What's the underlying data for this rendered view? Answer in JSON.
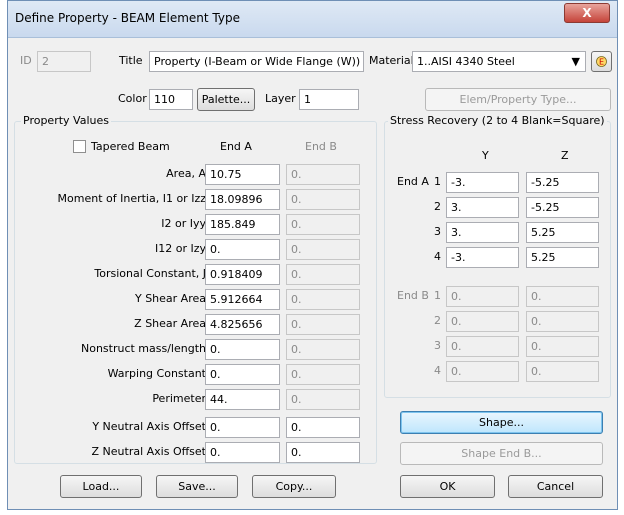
{
  "window": {
    "title": "Define Property - BEAM Element Type",
    "close_label": "X"
  },
  "header": {
    "id_label": "ID",
    "id_value": "2",
    "title_label": "Title",
    "title_value": "Property (I-Beam or Wide Flange (W))",
    "material_label": "Material",
    "material_value": "1..AISI 4340 Steel",
    "color_label": "Color",
    "color_value": "110",
    "palette_label": "Palette...",
    "layer_label": "Layer",
    "layer_value": "1",
    "elem_prop_type_label": "Elem/Property Type..."
  },
  "property_values": {
    "legend": "Property Values",
    "tapered_beam_label": "Tapered Beam",
    "tapered_beam_checked": false,
    "col_end_a": "End A",
    "col_end_b": "End B",
    "rows": [
      {
        "label": "Area, A",
        "end_a": "10.75",
        "end_b": "0."
      },
      {
        "label": "Moment of Inertia, I1 or Izz",
        "end_a": "18.09896",
        "end_b": "0."
      },
      {
        "label": "I2 or Iyy",
        "end_a": "185.849",
        "end_b": "0."
      },
      {
        "label": "I12 or Izy",
        "end_a": "0.",
        "end_b": "0."
      },
      {
        "label": "Torsional Constant, J",
        "end_a": "0.918409",
        "end_b": "0."
      },
      {
        "label": "Y Shear Area",
        "end_a": "5.912664",
        "end_b": "0."
      },
      {
        "label": "Z Shear Area",
        "end_a": "4.825656",
        "end_b": "0."
      },
      {
        "label": "Nonstruct mass/length",
        "end_a": "0.",
        "end_b": "0."
      },
      {
        "label": "Warping Constant",
        "end_a": "0.",
        "end_b": "0."
      },
      {
        "label": "Perimeter",
        "end_a": "44.",
        "end_b": "0."
      },
      {
        "label": "Y Neutral Axis Offset",
        "end_a": "0.",
        "end_b": "0."
      },
      {
        "label": "Z Neutral Axis Offset",
        "end_a": "0.",
        "end_b": "0."
      }
    ]
  },
  "stress_recovery": {
    "legend": "Stress Recovery (2 to 4 Blank=Square)",
    "col_y": "Y",
    "col_z": "Z",
    "end_a_label": "End A",
    "end_b_label": "End B",
    "end_a_rows": [
      {
        "num": "1",
        "y": "-3.",
        "z": "-5.25"
      },
      {
        "num": "2",
        "y": "3.",
        "z": "-5.25"
      },
      {
        "num": "3",
        "y": "3.",
        "z": "5.25"
      },
      {
        "num": "4",
        "y": "-3.",
        "z": "5.25"
      }
    ],
    "end_b_rows": [
      {
        "num": "1",
        "y": "0.",
        "z": "0."
      },
      {
        "num": "2",
        "y": "0.",
        "z": "0."
      },
      {
        "num": "3",
        "y": "0.",
        "z": "0."
      },
      {
        "num": "4",
        "y": "0.",
        "z": "0."
      }
    ]
  },
  "buttons": {
    "shape": "Shape...",
    "shape_end_b": "Shape End B...",
    "load": "Load...",
    "save": "Save...",
    "copy": "Copy...",
    "ok": "OK",
    "cancel": "Cancel"
  }
}
